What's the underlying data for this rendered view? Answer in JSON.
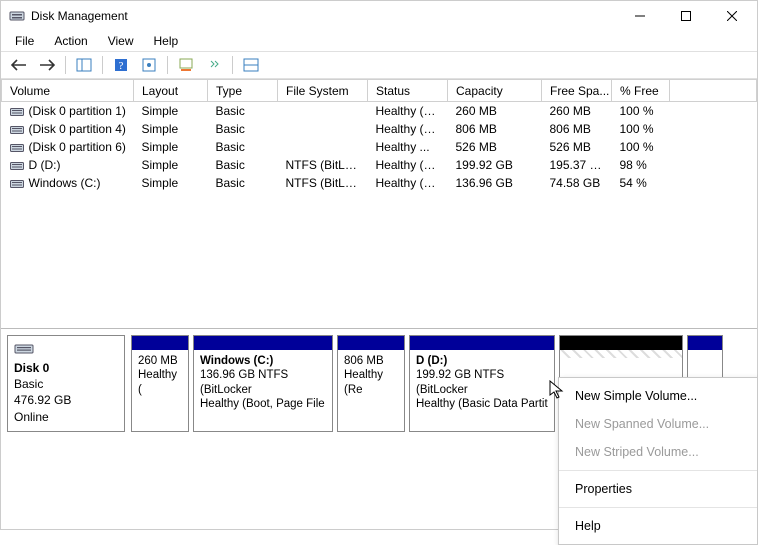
{
  "window": {
    "title": "Disk Management"
  },
  "menu": {
    "file": "File",
    "action": "Action",
    "view": "View",
    "help": "Help"
  },
  "toolbar": {
    "back": "back",
    "forward": "forward",
    "show_hide_tree": "show-hide-console-tree",
    "help_btn": "help",
    "action_center": "settings",
    "refresh": "refresh",
    "list_view": "list",
    "graphic_view": "graphical"
  },
  "columns": {
    "volume": "Volume",
    "layout": "Layout",
    "type": "Type",
    "filesystem": "File System",
    "status": "Status",
    "capacity": "Capacity",
    "freespace": "Free Spa...",
    "pctfree": "% Free"
  },
  "volumes": [
    {
      "name": "(Disk 0 partition 1)",
      "layout": "Simple",
      "type": "Basic",
      "fs": "",
      "status": "Healthy (E...",
      "capacity": "260 MB",
      "free": "260 MB",
      "pct": "100 %"
    },
    {
      "name": "(Disk 0 partition 4)",
      "layout": "Simple",
      "type": "Basic",
      "fs": "",
      "status": "Healthy (R...",
      "capacity": "806 MB",
      "free": "806 MB",
      "pct": "100 %"
    },
    {
      "name": "(Disk 0 partition 6)",
      "layout": "Simple",
      "type": "Basic",
      "fs": "",
      "status": "Healthy ...",
      "capacity": "526 MB",
      "free": "526 MB",
      "pct": "100 %"
    },
    {
      "name": "D (D:)",
      "layout": "Simple",
      "type": "Basic",
      "fs": "NTFS (BitLo...",
      "status": "Healthy (B...",
      "capacity": "199.92 GB",
      "free": "195.37 GB",
      "pct": "98 %"
    },
    {
      "name": "Windows (C:)",
      "layout": "Simple",
      "type": "Basic",
      "fs": "NTFS (BitLo...",
      "status": "Healthy (B...",
      "capacity": "136.96 GB",
      "free": "74.58 GB",
      "pct": "54 %"
    }
  ],
  "disk": {
    "name": "Disk 0",
    "type": "Basic",
    "size": "476.92 GB",
    "state": "Online"
  },
  "parts": {
    "p1": {
      "name": "",
      "l1": "260 MB",
      "l2": "Healthy ("
    },
    "p2": {
      "name": "Windows  (C:)",
      "l1": "136.96 GB NTFS (BitLocker",
      "l2": "Healthy (Boot, Page File"
    },
    "p3": {
      "name": "",
      "l1": "806 MB",
      "l2": "Healthy (Re"
    },
    "p4": {
      "name": "D  (D:)",
      "l1": "199.92 GB NTFS (BitLocker",
      "l2": "Healthy (Basic Data Partit"
    },
    "p5": {
      "name": "",
      "l1": "",
      "l2": ""
    },
    "p6": {
      "name": "",
      "l1": "",
      "l2": ""
    }
  },
  "context": {
    "new_simple": "New Simple Volume...",
    "new_spanned": "New Spanned Volume...",
    "new_striped": "New Striped Volume...",
    "properties": "Properties",
    "help": "Help"
  }
}
